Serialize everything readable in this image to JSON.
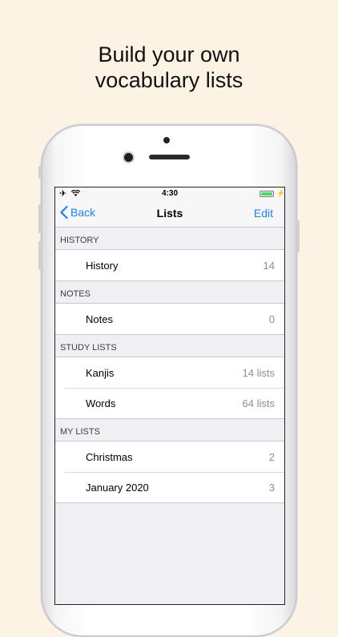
{
  "headline": {
    "line1": "Build your own",
    "line2": "vocabulary lists"
  },
  "status_bar": {
    "time": "4:30",
    "airplane_icon": "airplane-icon",
    "wifi_icon": "wifi-icon",
    "battery_color": "#4cd964"
  },
  "nav": {
    "back_label": "Back",
    "title": "Lists",
    "edit_label": "Edit",
    "accent_color": "#1a82fb"
  },
  "sections": [
    {
      "header": "HISTORY",
      "rows": [
        {
          "label": "History",
          "count": "14"
        }
      ]
    },
    {
      "header": "NOTES",
      "rows": [
        {
          "label": "Notes",
          "count": "0"
        }
      ]
    },
    {
      "header": "STUDY LISTS",
      "rows": [
        {
          "label": "Kanjis",
          "count": "14 lists"
        },
        {
          "label": "Words",
          "count": "64 lists"
        }
      ]
    },
    {
      "header": "MY LISTS",
      "rows": [
        {
          "label": "Christmas",
          "count": "2"
        },
        {
          "label": "January 2020",
          "count": "3"
        }
      ]
    }
  ]
}
